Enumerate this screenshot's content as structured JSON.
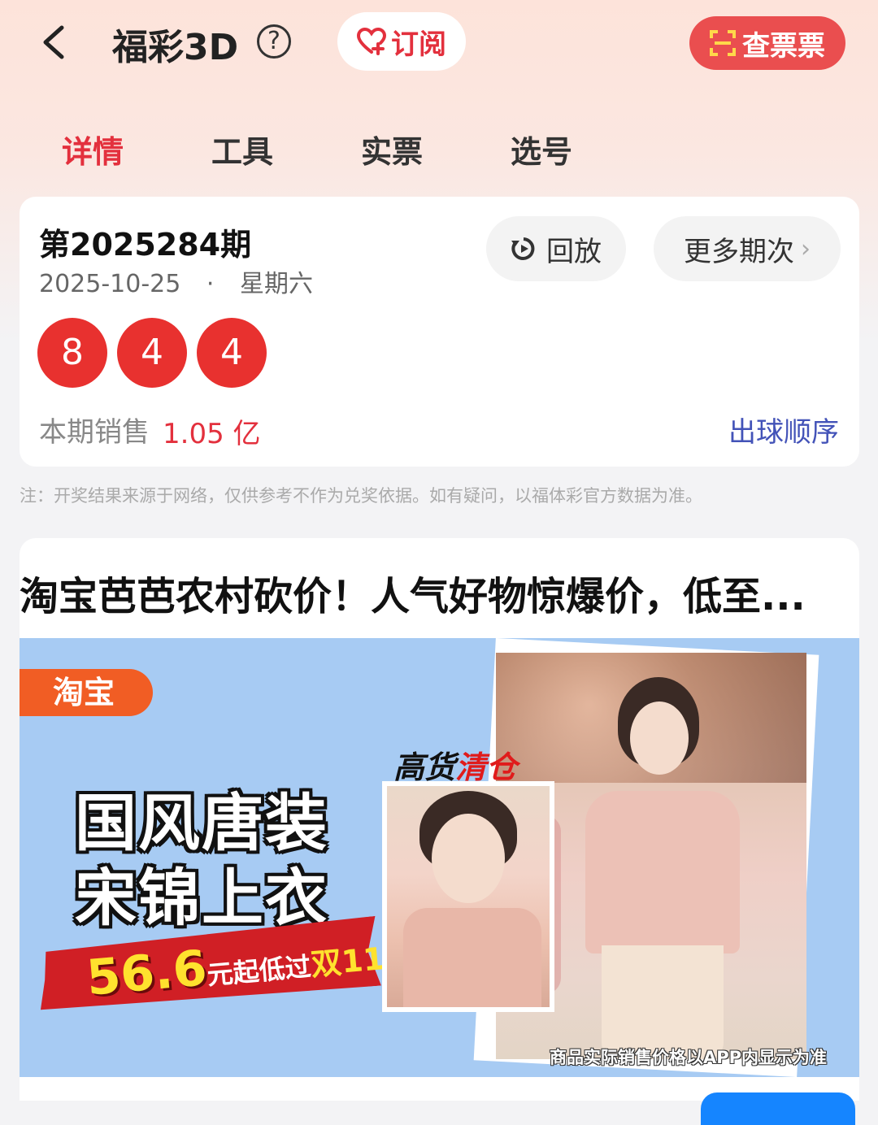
{
  "header": {
    "title": "福彩3D",
    "help_symbol": "?",
    "subscribe_label": "订阅",
    "check_ticket_label": "查票票"
  },
  "tabs": [
    {
      "label": "详情",
      "active": true
    },
    {
      "label": "工具",
      "active": false
    },
    {
      "label": "实票",
      "active": false
    },
    {
      "label": "选号",
      "active": false
    }
  ],
  "draw": {
    "issue": "第2025284期",
    "date": "2025-10-25",
    "separator": "·",
    "weekday": "星期六",
    "replay_label": "回放",
    "more_label": "更多期次",
    "more_chevron": "›",
    "numbers": [
      "8",
      "4",
      "4"
    ],
    "sales_label": "本期销售",
    "sales_value": "1.05 亿",
    "order_link": "出球顺序"
  },
  "note": "注：开奖结果来源于网络，仅供参考不作为兑奖依据。如有疑问，以福体彩官方数据为准。",
  "ad": {
    "title": "淘宝芭芭农村砍价！人气好物惊爆价，低至...",
    "badge": "淘宝",
    "line1": "国风唐装",
    "line2": "宋锦上衣",
    "price": "56.6",
    "price_suffix": "元起低过",
    "price_suffix2": "双11",
    "hot_label_black": "高货",
    "hot_label_red": "清仓",
    "disclaimer": "商品实际销售价格以APP内显示为准"
  },
  "colors": {
    "accent_red": "#e3303d",
    "ball_red": "#e8312f",
    "link_blue": "#4353b8",
    "taobao_orange": "#f15d24"
  },
  "icons": [
    "back-arrow-icon",
    "help-icon",
    "heart-plus-icon",
    "scan-icon",
    "replay-icon",
    "chevron-right-icon"
  ]
}
